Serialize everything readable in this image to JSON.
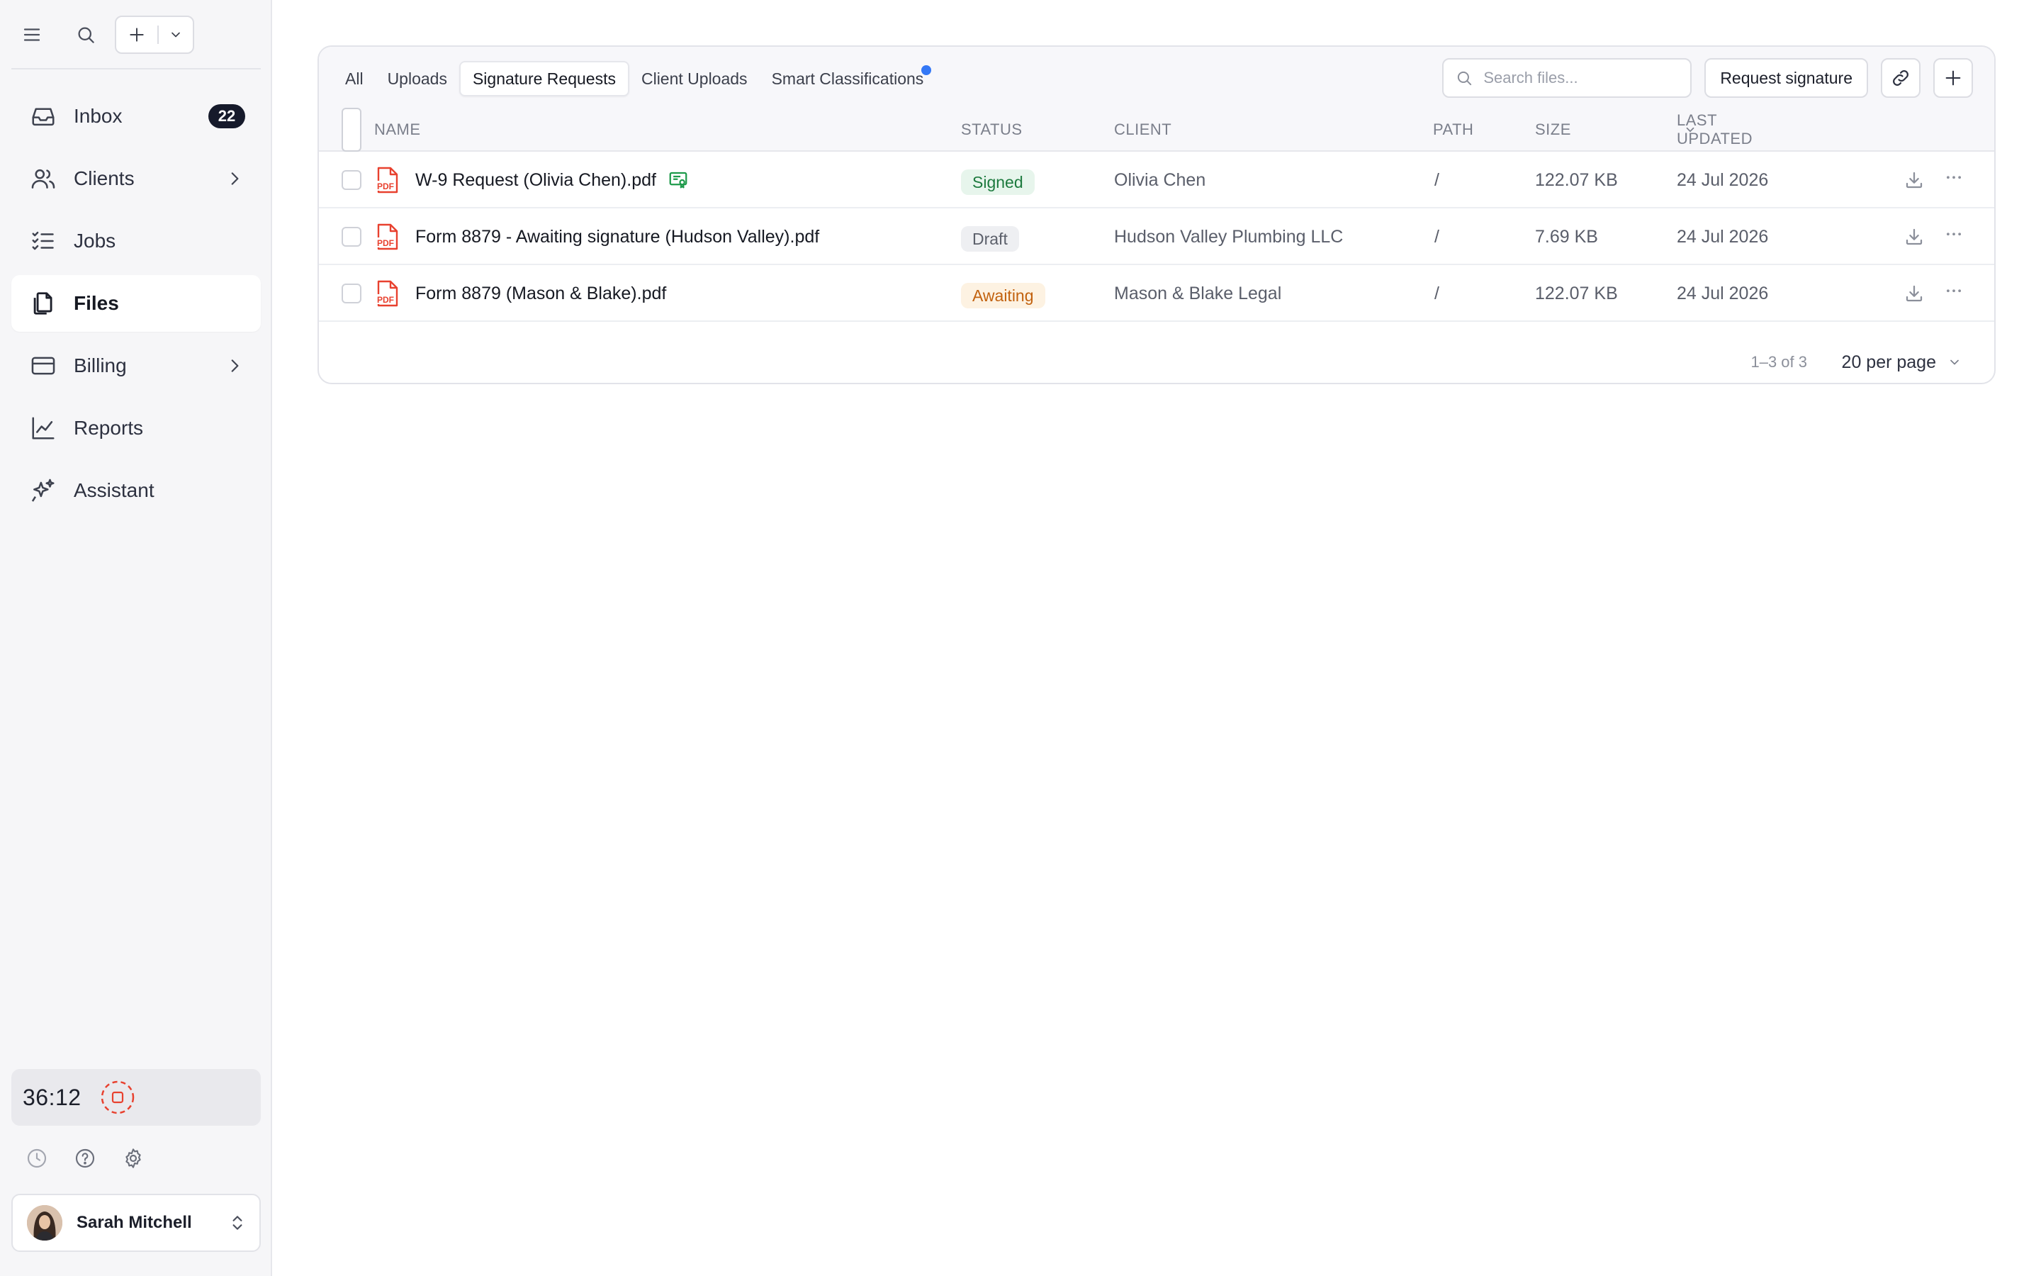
{
  "sidebar": {
    "nav": [
      {
        "label": "Inbox",
        "icon": "inbox-icon",
        "badge": "22"
      },
      {
        "label": "Clients",
        "icon": "users-icon"
      },
      {
        "label": "Jobs",
        "icon": "checklist-icon"
      },
      {
        "label": "Files",
        "icon": "files-icon",
        "active": true
      },
      {
        "label": "Billing",
        "icon": "credit-card-icon"
      },
      {
        "label": "Reports",
        "icon": "chart-line-icon"
      },
      {
        "label": "Assistant",
        "icon": "sparkles-icon"
      }
    ],
    "timer": "36:12",
    "user": {
      "name": "Sarah Mitchell"
    }
  },
  "files": {
    "tabs": [
      "All",
      "Uploads",
      "Signature Requests",
      "Client Uploads",
      "Smart Classifications"
    ],
    "active_tab": "Signature Requests",
    "search_placeholder": "Search files...",
    "request_button": "Request signature",
    "columns": {
      "name": "NAME",
      "status": "STATUS",
      "client": "CLIENT",
      "path": "PATH",
      "size": "SIZE",
      "updated": "LAST UPDATED"
    },
    "rows": [
      {
        "name": "W-9 Request (Olivia Chen).pdf",
        "status": "Signed",
        "client": "Olivia Chen",
        "path": "/",
        "size": "122.07 KB",
        "updated": "24 Jul 2026"
      },
      {
        "name": "Form 8879 - Awaiting signature (Hudson Valley).pdf",
        "status": "Draft",
        "client": "Hudson Valley Plumbing LLC",
        "path": "/",
        "size": "7.69 KB",
        "updated": "24 Jul 2026"
      },
      {
        "name": "Form 8879 (Mason & Blake).pdf",
        "status": "Awaiting",
        "client": "Mason & Blake Legal",
        "path": "/",
        "size": "122.07 KB",
        "updated": "24 Jul 2026"
      }
    ],
    "pagination": {
      "range": "1–3 of 3",
      "per_page": "20 per page"
    }
  },
  "colors": {
    "signed": "#1d7a3e",
    "draft": "#5c606b",
    "awaiting": "#c2620f",
    "badge_bg": "#161a2b",
    "pdf_red": "#e8412f",
    "notify_dot": "#3478f6",
    "timer_red": "#e8412f"
  }
}
